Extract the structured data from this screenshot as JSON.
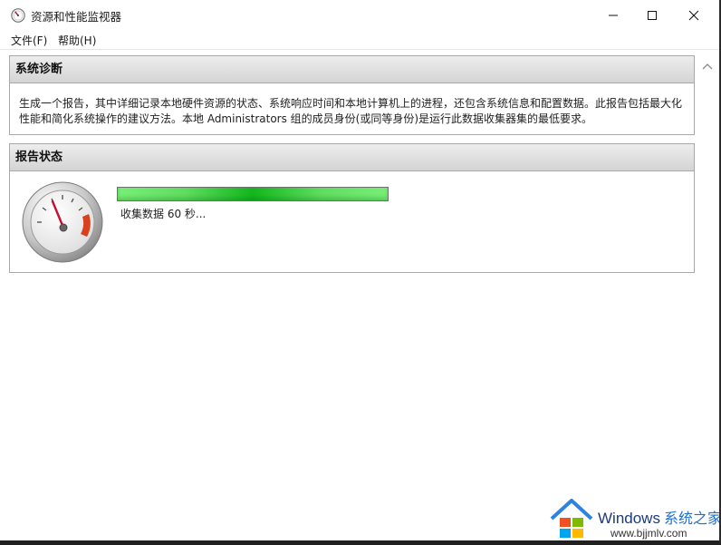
{
  "window": {
    "title": "资源和性能监视器",
    "app_icon": "speedometer-icon",
    "controls": {
      "minimize": "minimize-icon",
      "maximize": "maximize-icon",
      "close": "close-icon"
    }
  },
  "menu": {
    "file": "文件(F)",
    "help": "帮助(H)"
  },
  "system_diagnostics": {
    "header": "系统诊断",
    "description": "生成一个报告，其中详细记录本地硬件资源的状态、系统响应时间和本地计算机上的进程，还包含系统信息和配置数据。此报告包括最大化性能和简化系统操作的建议方法。本地 Administrators 组的成员身份(或同等身份)是运行此数据收集器集的最低要求。"
  },
  "report_status": {
    "header": "报告状态",
    "gauge_icon": "gauge-icon",
    "progress_fraction": 1.0,
    "status_text": "收集数据 60 秒..."
  },
  "watermark": {
    "brand": "Windows",
    "brand_cn": "系统之家",
    "url": "www.bjjmlv.com"
  },
  "colors": {
    "progress_green": "#12b61d",
    "header_gray": "#dcdcdc",
    "brand_blue": "#1f6fd1"
  }
}
